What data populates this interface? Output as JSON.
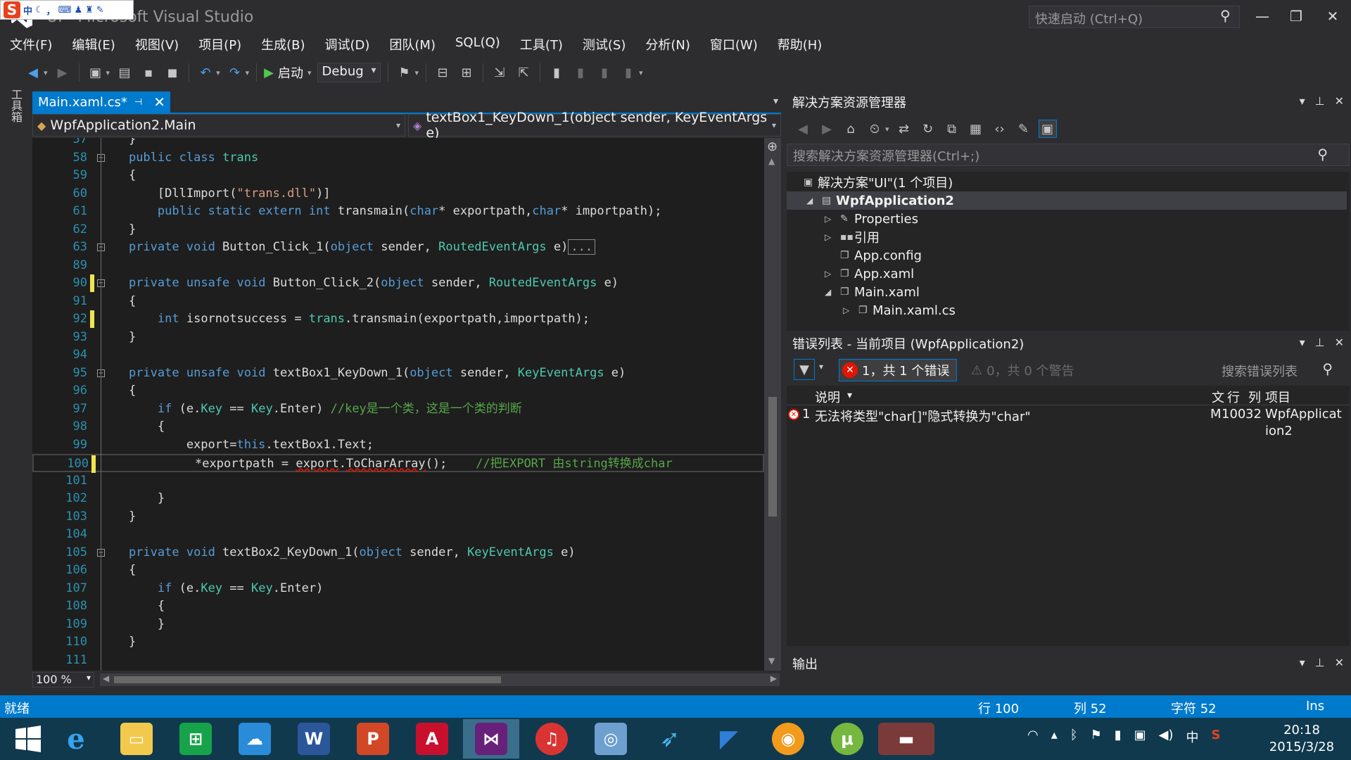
{
  "window": {
    "title": "UI - Microsoft Visual Studio",
    "quick_launch_placeholder": "快速启动 (Ctrl+Q)"
  },
  "ime_bar": {
    "items": [
      "中",
      "°",
      "，"
    ]
  },
  "menu": [
    "文件(F)",
    "编辑(E)",
    "视图(V)",
    "项目(P)",
    "生成(B)",
    "调试(D)",
    "团队(M)",
    "SQL(Q)",
    "工具(T)",
    "测试(S)",
    "分析(N)",
    "窗口(W)",
    "帮助(H)"
  ],
  "toolbar": {
    "start_label": "启动",
    "config_value": "Debug"
  },
  "toolbox_label": "工具箱",
  "document_tab": {
    "label": "Main.xaml.cs*"
  },
  "nav": {
    "class_label": "WpfApplication2.Main",
    "member_label": "textBox1_KeyDown_1(object sender, KeyEventArgs e)"
  },
  "code_lines": [
    {
      "ln": "57",
      "text": "    }"
    },
    {
      "ln": "58",
      "text": "    public class trans"
    },
    {
      "ln": "59",
      "text": "    {"
    },
    {
      "ln": "60",
      "text": "        [DllImport(\"trans.dll\")]"
    },
    {
      "ln": "61",
      "text": "        public static extern int transmain(char* exportpath,char* importpath);"
    },
    {
      "ln": "62",
      "text": "    }"
    },
    {
      "ln": "63",
      "text": "    private void Button_Click_1(object sender, RoutedEventArgs e)..."
    },
    {
      "ln": "89",
      "text": ""
    },
    {
      "ln": "90",
      "text": "    private unsafe void Button_Click_2(object sender, RoutedEventArgs e)"
    },
    {
      "ln": "91",
      "text": "    {"
    },
    {
      "ln": "92",
      "text": "        int isornotsuccess = trans.transmain(exportpath,importpath);"
    },
    {
      "ln": "93",
      "text": "    }"
    },
    {
      "ln": "94",
      "text": ""
    },
    {
      "ln": "95",
      "text": "    private unsafe void textBox1_KeyDown_1(object sender, KeyEventArgs e)"
    },
    {
      "ln": "96",
      "text": "    {"
    },
    {
      "ln": "97",
      "text": "        if (e.Key == Key.Enter) //key是一个类，这是一个类的判断"
    },
    {
      "ln": "98",
      "text": "        {"
    },
    {
      "ln": "99",
      "text": "            export=this.textBox1.Text;"
    },
    {
      "ln": "100",
      "text": "             *exportpath = export.ToCharArray();    //把EXPORT 由string转换成char"
    },
    {
      "ln": "101",
      "text": ""
    },
    {
      "ln": "102",
      "text": "        }"
    },
    {
      "ln": "103",
      "text": "    }"
    },
    {
      "ln": "104",
      "text": ""
    },
    {
      "ln": "105",
      "text": "    private void textBox2_KeyDown_1(object sender, KeyEventArgs e)"
    },
    {
      "ln": "106",
      "text": "    {"
    },
    {
      "ln": "107",
      "text": "        if (e.Key == Key.Enter)"
    },
    {
      "ln": "108",
      "text": "        {"
    },
    {
      "ln": "109",
      "text": "        }"
    },
    {
      "ln": "110",
      "text": "    }"
    },
    {
      "ln": "111",
      "text": ""
    }
  ],
  "editor_zoom": "100 %",
  "solution_explorer": {
    "title": "解决方案资源管理器",
    "search_placeholder": "搜索解决方案资源管理器(Ctrl+;)",
    "tree": [
      {
        "label": "解决方案\"UI\"(1 个项目)",
        "indent": 0,
        "expander": "",
        "icon": "solution-icon"
      },
      {
        "label": "WpfApplication2",
        "indent": 1,
        "expander": "◢",
        "icon": "project-icon",
        "selected": true
      },
      {
        "label": "Properties",
        "indent": 2,
        "expander": "▷",
        "icon": "wrench-icon"
      },
      {
        "label": "引用",
        "indent": 2,
        "expander": "▷",
        "icon": "references-icon"
      },
      {
        "label": "App.config",
        "indent": 2,
        "expander": "",
        "icon": "config-file-icon"
      },
      {
        "label": "App.xaml",
        "indent": 2,
        "expander": "▷",
        "icon": "xaml-file-icon"
      },
      {
        "label": "Main.xaml",
        "indent": 2,
        "expander": "◢",
        "icon": "xaml-file-icon"
      },
      {
        "label": "Main.xaml.cs",
        "indent": 3,
        "expander": "▷",
        "icon": "cs-file-icon"
      }
    ]
  },
  "error_list": {
    "title": "错误列表 - 当前项目 (WpfApplication2)",
    "errors_label": "1，共 1 个错误",
    "warnings_label": "0，共 0 个警告",
    "search_placeholder": "搜索错误列表",
    "columns": {
      "desc": "说明",
      "file": "文",
      "line": "行",
      "col": "列",
      "project": "项目"
    },
    "rows": [
      {
        "num": "1",
        "desc": "无法将类型\"char[]\"隐式转换为\"char\"",
        "file": "M",
        "line": "100",
        "col": "32",
        "project_line1": "WpfApplicat",
        "project_line2": "ion2"
      }
    ]
  },
  "output_pane": {
    "title": "输出"
  },
  "statusbar": {
    "ready": "就绪",
    "line": "行 100",
    "col": "列 52",
    "char": "字符 52",
    "mode": "Ins"
  },
  "taskbar": {
    "apps": [
      "windows-start",
      "internet-explorer",
      "file-explorer",
      "store",
      "baidu-cloud",
      "word",
      "powerpoint",
      "acrobat",
      "visual-studio",
      "netease-music",
      "browser",
      "bird-app",
      "shark-app",
      "wifi-app",
      "utorrent",
      "app"
    ],
    "time": "20:18",
    "date": "2015/3/28",
    "ime": "中"
  }
}
